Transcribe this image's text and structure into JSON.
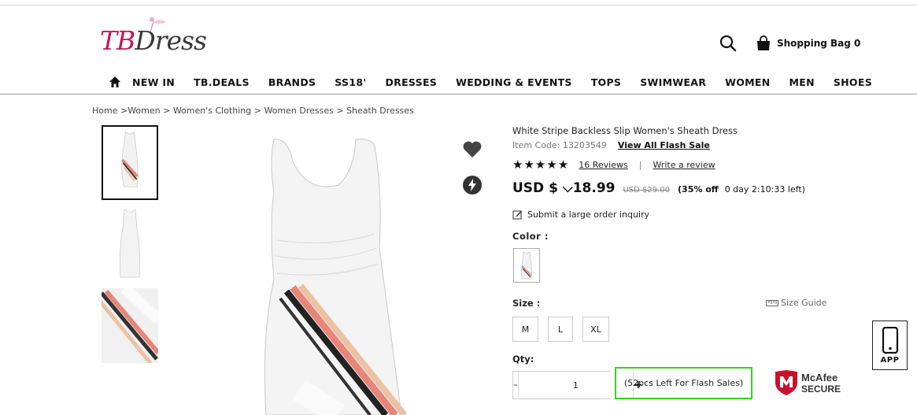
{
  "brand": {
    "logo_main": "TB",
    "logo_accent": "Dress"
  },
  "header": {
    "search_icon": "search-icon",
    "bag_icon": "shopping-bag-icon",
    "bag_label": "Shopping Bag 0"
  },
  "nav": {
    "home_icon": "home-icon",
    "items": [
      "NEW IN",
      "TB.DEALS",
      "BRANDS",
      "SS18'",
      "DRESSES",
      "WEDDING & EVENTS",
      "TOPS",
      "SWIMWEAR",
      "WOMEN",
      "MEN",
      "SHOES"
    ]
  },
  "breadcrumb": "Home >Women > Women's Clothing > Women Dresses > Sheath Dresses",
  "product": {
    "title": "White Stripe Backless Slip Women's Sheath Dress",
    "item_code": "Item Code: 13203549",
    "flash_link": "View All Flash Sale",
    "stars": "★★★★★",
    "reviews": "16 Reviews",
    "separator": "|",
    "write_review": "Write a review",
    "price": "USD $ ⌵18.99",
    "old_price": "USD $29.00",
    "discount": "(35% off",
    "time_left": "0 day 2:10:33 left)",
    "inquiry": "Submit a large order inquiry",
    "color_label": "Color :",
    "size_label": "Size :",
    "size_guide": "Size Guide",
    "sizes": [
      "M",
      "L",
      "XL"
    ],
    "qty_label": "Qty:",
    "qty_minus": "-",
    "qty_value": "1",
    "qty_plus": "+",
    "flash_stock": "(52pcs Left For Flash Sales)"
  },
  "badges": {
    "mcafee_line1": "McAfee",
    "mcafee_line2": "SECURE",
    "app_label": "APP"
  },
  "colors": {
    "brand": "#c2185b",
    "flash_border": "#3ad11f",
    "mcafee_red": "#c8102e"
  }
}
